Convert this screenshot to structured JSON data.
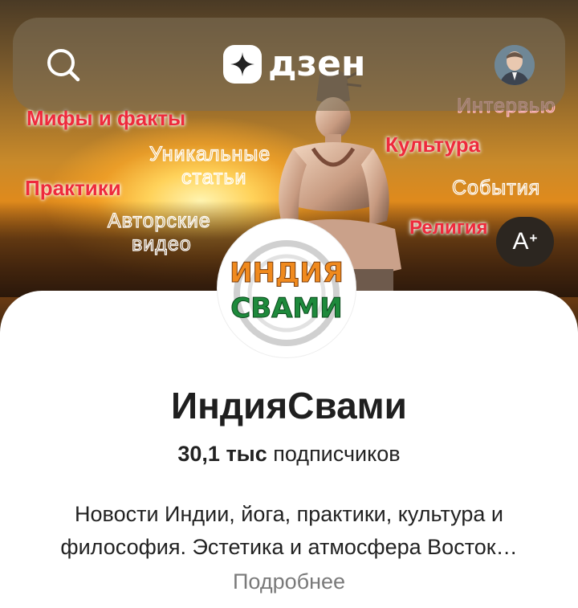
{
  "topbar": {
    "search_icon": "search-icon",
    "logo_text": "дзен",
    "logo_icon": "zen-star-icon",
    "avatar_icon": "user-avatar"
  },
  "cover": {
    "words": {
      "myths": "Мифы и факты",
      "interview": "Интервью",
      "unique": "Уникальные",
      "articles": "статьи",
      "culture": "Культура",
      "practices": "Практики",
      "events": "События",
      "author": "Авторские",
      "video": "видео",
      "religion": "Религия"
    }
  },
  "font_button": {
    "label": "A",
    "sup": "+"
  },
  "channel": {
    "logo_line1": "ИНДИЯ",
    "logo_line2": "СВАМИ",
    "name": "ИндияСвами",
    "subscribers_count": "30,1 тыс",
    "subscribers_label": "подписчиков",
    "description": "Новости Индии, йога, практики, культура и философия. Эстетика и атмосфера Восток…",
    "more_label": "Подробнее"
  },
  "colors": {
    "accent_red": "#ee2a3c",
    "text_dark": "#1f1f1f",
    "text_muted": "#7a7a7a",
    "saffron": "#f08a1e",
    "green": "#1e8a3c"
  }
}
